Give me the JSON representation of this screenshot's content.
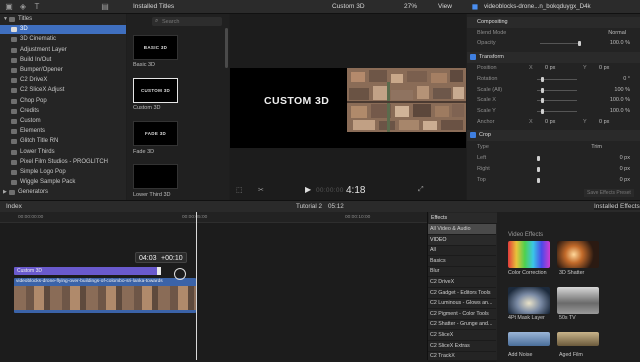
{
  "libraries": {
    "items": [
      {
        "label": "Titles",
        "expanded": true
      },
      {
        "label": "3D",
        "selected": true
      },
      {
        "label": "3D Cinematic"
      },
      {
        "label": "Adjustment Layer"
      },
      {
        "label": "Build In/Out"
      },
      {
        "label": "Bumper/Opener"
      },
      {
        "label": "C2 DriveX"
      },
      {
        "label": "C2 SliceX Adjust"
      },
      {
        "label": "Chop Pop"
      },
      {
        "label": "Credits"
      },
      {
        "label": "Custom"
      },
      {
        "label": "Elements"
      },
      {
        "label": "Glitch Title RN"
      },
      {
        "label": "Lower Thirds"
      },
      {
        "label": "Pixel Film Studios - PROGLITCH"
      },
      {
        "label": "Simple Logo Pop"
      },
      {
        "label": "Wiggle Sample Pack"
      },
      {
        "label": "Generators",
        "expanded": false
      }
    ]
  },
  "browser": {
    "title": "Installed Titles",
    "search_placeholder": "Search",
    "titles": [
      {
        "thumb": "BASIC 3D",
        "caption": "Basic 3D"
      },
      {
        "thumb": "CUSTOM 3D",
        "caption": "Custom 3D",
        "selected": true
      },
      {
        "thumb": "FADE 3D",
        "caption": "Fade 3D"
      },
      {
        "thumb": "",
        "caption": "Lower Third 3D"
      }
    ]
  },
  "viewer": {
    "title": "Custom 3D",
    "zoom": "27%",
    "view": "View",
    "title_text": "CUSTOM 3D",
    "timecode": "4:18",
    "timecode_prefix": "00:00:00"
  },
  "inspector": {
    "clip_name": "videoblocks-drone...n_bokqduygx_D4k",
    "compositing": {
      "header": "Compositing",
      "blend_mode_label": "Blend Mode",
      "blend_mode": "Normal",
      "opacity_label": "Opacity",
      "opacity": "100.0 %",
      "opacity_level": 1.0
    },
    "transform": {
      "header": "Transform",
      "rows": [
        {
          "label": "Position",
          "x_label": "X",
          "x": "0 px",
          "y_label": "Y",
          "y": "0 px"
        },
        {
          "label": "Rotation",
          "value": "0 °"
        },
        {
          "label": "Scale (All)",
          "value": "100 %"
        },
        {
          "label": "Scale X",
          "value": "100.0 %"
        },
        {
          "label": "Scale Y",
          "value": "100.0 %"
        },
        {
          "label": "Anchor",
          "x_label": "X",
          "x": "0 px",
          "y_label": "Y",
          "y": "0 px"
        }
      ]
    },
    "crop": {
      "header": "Crop",
      "type_label": "Type",
      "type": "Trim",
      "rows": [
        {
          "label": "Left",
          "value": "0 px"
        },
        {
          "label": "Right",
          "value": "0 px"
        },
        {
          "label": "Top",
          "value": "0 px"
        }
      ]
    },
    "save_preset": "Save Effects Preset"
  },
  "timeline": {
    "index_label": "Index",
    "project": "Tutorial 2",
    "duration": "05:12",
    "ruler": [
      "00:00:00:00",
      "00:00:05:00",
      "00:00:10:00"
    ],
    "drag_tooltip_a": "04:03",
    "drag_tooltip_b": "+00:10",
    "title_clip": "Custom 3D",
    "video_clip": "videoblocks-drone-flying-over-buildings-of-colombo-sri-lanka-towards"
  },
  "effects": {
    "header": "Effects",
    "installed": "Installed Effects",
    "categories": [
      {
        "label": "All Video & Audio",
        "selected": true
      },
      {
        "label": "VIDEO",
        "heading": true
      },
      {
        "label": "All"
      },
      {
        "label": "Basics"
      },
      {
        "label": "Blur"
      },
      {
        "label": "C2 DriveX"
      },
      {
        "label": "C2 Gadget - Editors Tools"
      },
      {
        "label": "C2 Luminous - Glows an..."
      },
      {
        "label": "C2 Pigment - Color Tools"
      },
      {
        "label": "C2 Shatter - Grunge and..."
      },
      {
        "label": "C2 SliceX"
      },
      {
        "label": "C2 SliceX Extras"
      },
      {
        "label": "C2 TrackX"
      }
    ],
    "section": "Video Effects",
    "tiles": [
      {
        "caption": "Color Correction"
      },
      {
        "caption": "3D Shatter"
      },
      {
        "caption": "4Pt Mask Layer"
      },
      {
        "caption": "50s TV"
      },
      {
        "caption": "Add Noise"
      },
      {
        "caption": "Aged Film"
      }
    ]
  },
  "colors": {
    "accent": "#3f6fbf",
    "title_clip": "#6a5acd",
    "video_clip": "#3b63a8",
    "checkbox": "#3f7fe0"
  }
}
